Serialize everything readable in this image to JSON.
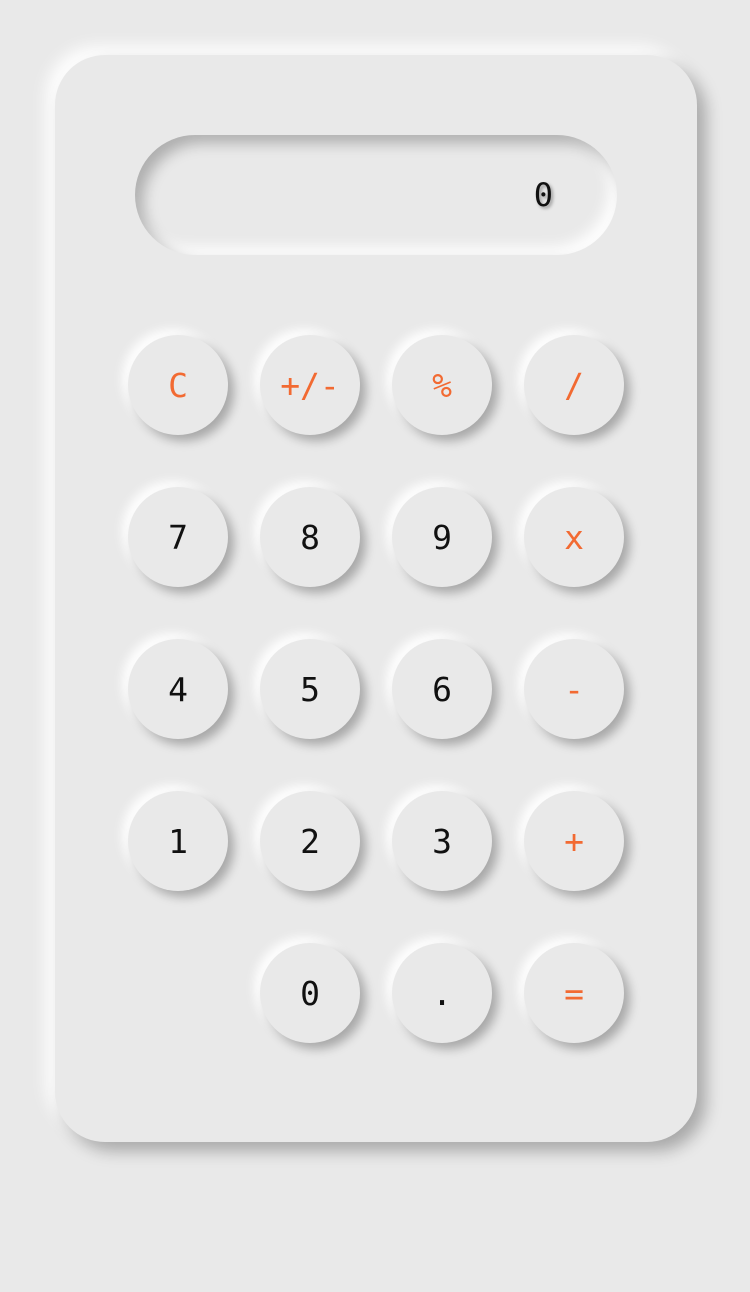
{
  "display": {
    "value": "0"
  },
  "colors": {
    "accent": "#f26a32",
    "text": "#111111",
    "surface": "#e9e9e9"
  },
  "keys": {
    "clear": "C",
    "sign": "+/-",
    "percent": "%",
    "divide": "/",
    "seven": "7",
    "eight": "8",
    "nine": "9",
    "multiply": "x",
    "four": "4",
    "five": "5",
    "six": "6",
    "subtract": "-",
    "one": "1",
    "two": "2",
    "three": "3",
    "add": "+",
    "zero": "0",
    "decimal": ".",
    "equals": "="
  }
}
